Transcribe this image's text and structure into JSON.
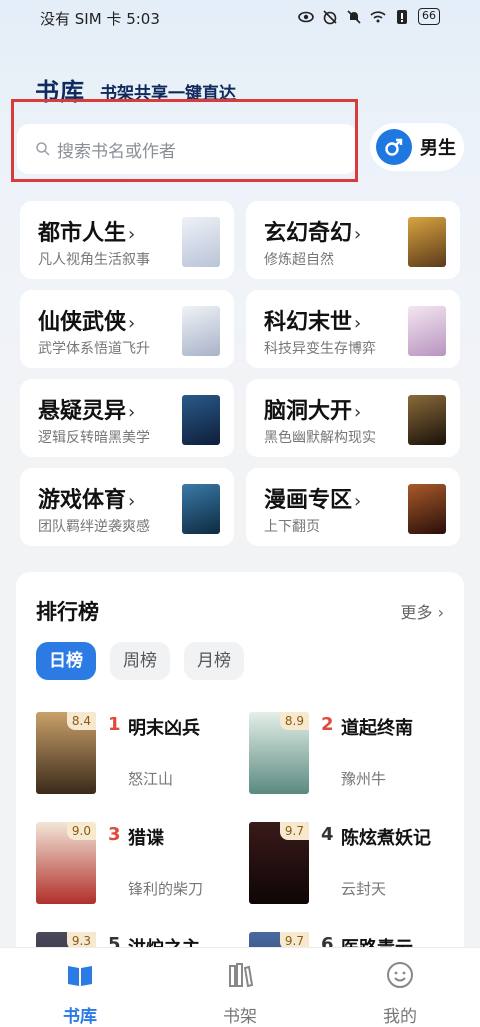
{
  "status_bar": {
    "carrier_time": "没有 SIM 卡 5:03",
    "battery": "66"
  },
  "header": {
    "title": "书库",
    "subtitle": "书架共享一键直达"
  },
  "search": {
    "placeholder": "搜索书名或作者",
    "icon": "search-icon"
  },
  "gender": {
    "label": "男生",
    "icon": "male-icon"
  },
  "categories": [
    {
      "name": "都市人生",
      "desc": "凡人视角生活叙事",
      "cover_color": "#cfd7e6"
    },
    {
      "name": "玄幻奇幻",
      "desc": "修炼超自然",
      "cover_color": "#6a4a2a"
    },
    {
      "name": "仙侠武侠",
      "desc": "武学体系悟道飞升",
      "cover_color": "#d8dde8"
    },
    {
      "name": "科幻末世",
      "desc": "科技异变生存博弈",
      "cover_color": "#e8d8e8"
    },
    {
      "name": "悬疑灵异",
      "desc": "逻辑反转暗黑美学",
      "cover_color": "#1e3a5e"
    },
    {
      "name": "脑洞大开",
      "desc": "黑色幽默解构现实",
      "cover_color": "#3a2a1a"
    },
    {
      "name": "游戏体育",
      "desc": "团队羁绊逆袭爽感",
      "cover_color": "#1e4a6a"
    },
    {
      "name": "漫画专区",
      "desc": "上下翻页",
      "cover_color": "#5a2a1a"
    }
  ],
  "ranking": {
    "title": "排行榜",
    "more": "更多",
    "tabs": [
      "日榜",
      "周榜",
      "月榜"
    ],
    "active_tab": "日榜",
    "books": [
      {
        "rank": "1",
        "name": "明末凶兵",
        "author": "怒江山",
        "score": "8.4",
        "cover_color": "#7a5a3a"
      },
      {
        "rank": "2",
        "name": "道起终南",
        "author": "豫州牛",
        "score": "8.9",
        "cover_color": "#7fa8a0"
      },
      {
        "rank": "3",
        "name": "猎谍",
        "author": "锋利的柴刀",
        "score": "9.0",
        "cover_color": "#c0392b"
      },
      {
        "rank": "4",
        "name": "陈炫煮妖记",
        "author": "云封天",
        "score": "9.7",
        "cover_color": "#2a1a1a"
      },
      {
        "rank": "5",
        "name": "洪炉之主",
        "author": "",
        "score": "9.3",
        "cover_color": "#3a3a4a"
      },
      {
        "rank": "6",
        "name": "医路青云",
        "author": "",
        "score": "9.7",
        "cover_color": "#2a4a7a"
      }
    ]
  },
  "bottom_nav": [
    {
      "label": "书库",
      "icon": "library-icon",
      "active": true
    },
    {
      "label": "书架",
      "icon": "bookshelf-icon",
      "active": false
    },
    {
      "label": "我的",
      "icon": "profile-icon",
      "active": false
    }
  ],
  "colors": {
    "accent": "#2c7be5",
    "highlight_border": "#d93a3a",
    "rank_top": "#e04a3a"
  }
}
